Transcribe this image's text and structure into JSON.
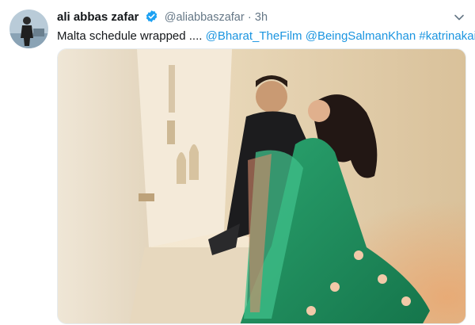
{
  "tweet": {
    "author_name": "ali abbas zafar",
    "author_handle": "@aliabbaszafar",
    "separator": "·",
    "timestamp": "3h",
    "text_plain": "Malta schedule wrapped ....",
    "mentions": [
      "@Bharat_TheFilm",
      "@BeingSalmanKhan"
    ],
    "hashtag": "#katrinakaif"
  },
  "icons": {
    "verified": "verified-badge-icon",
    "menu": "chevron-down-icon"
  },
  "colors": {
    "link": "#1b95e0",
    "verified": "#1da1f2",
    "muted": "#657786",
    "text": "#14171a",
    "dress": "#1f8f5f"
  }
}
